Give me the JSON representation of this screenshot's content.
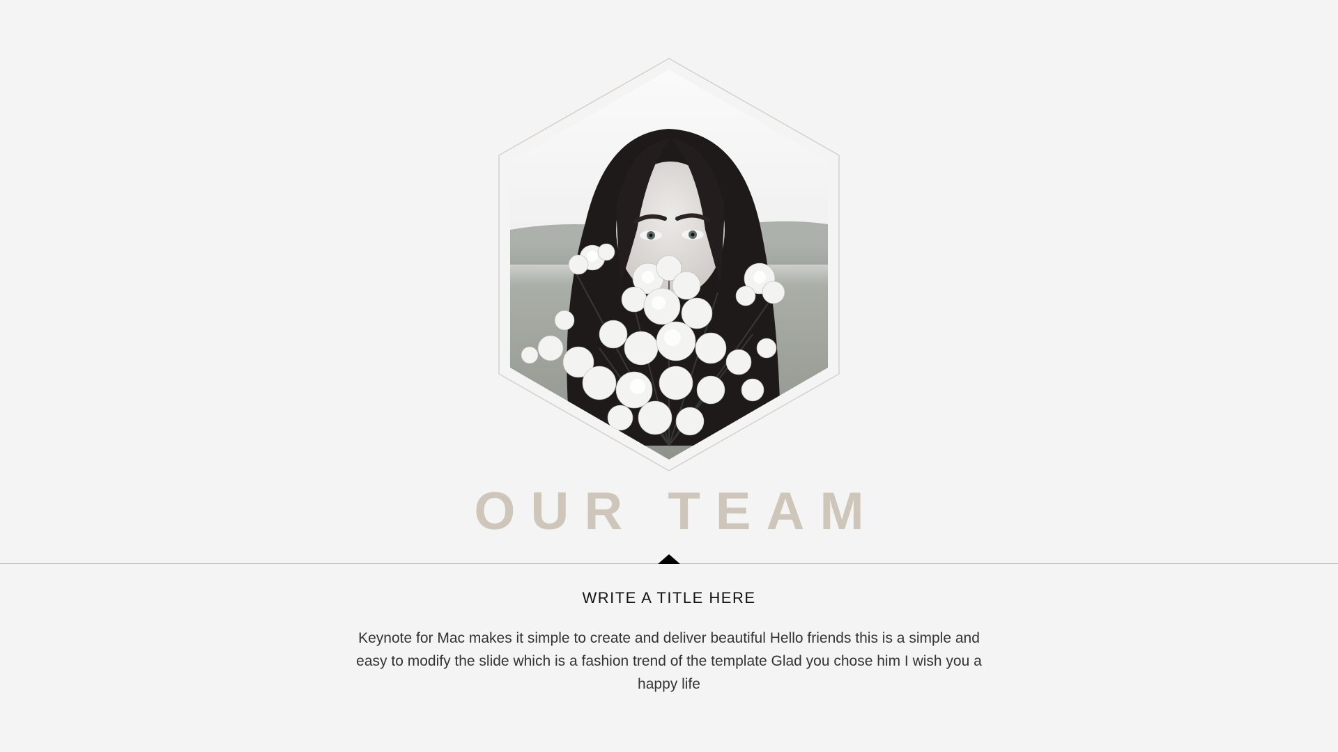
{
  "slide": {
    "heading": "OUR TEAM",
    "subtitle": "WRITE A TITLE HERE",
    "body": "Keynote for Mac makes it simple to create and deliver beautiful Hello friends this is a simple and easy to modify the slide which is a fashion trend of the template Glad you chose him I wish you a happy life",
    "image_description_icon": "portrait-photo",
    "colors": {
      "background": "#f4f4f4",
      "heading": "#cfc6bb",
      "divider": "#b8b8b8",
      "pointer": "#000000",
      "text": "#333333"
    }
  }
}
